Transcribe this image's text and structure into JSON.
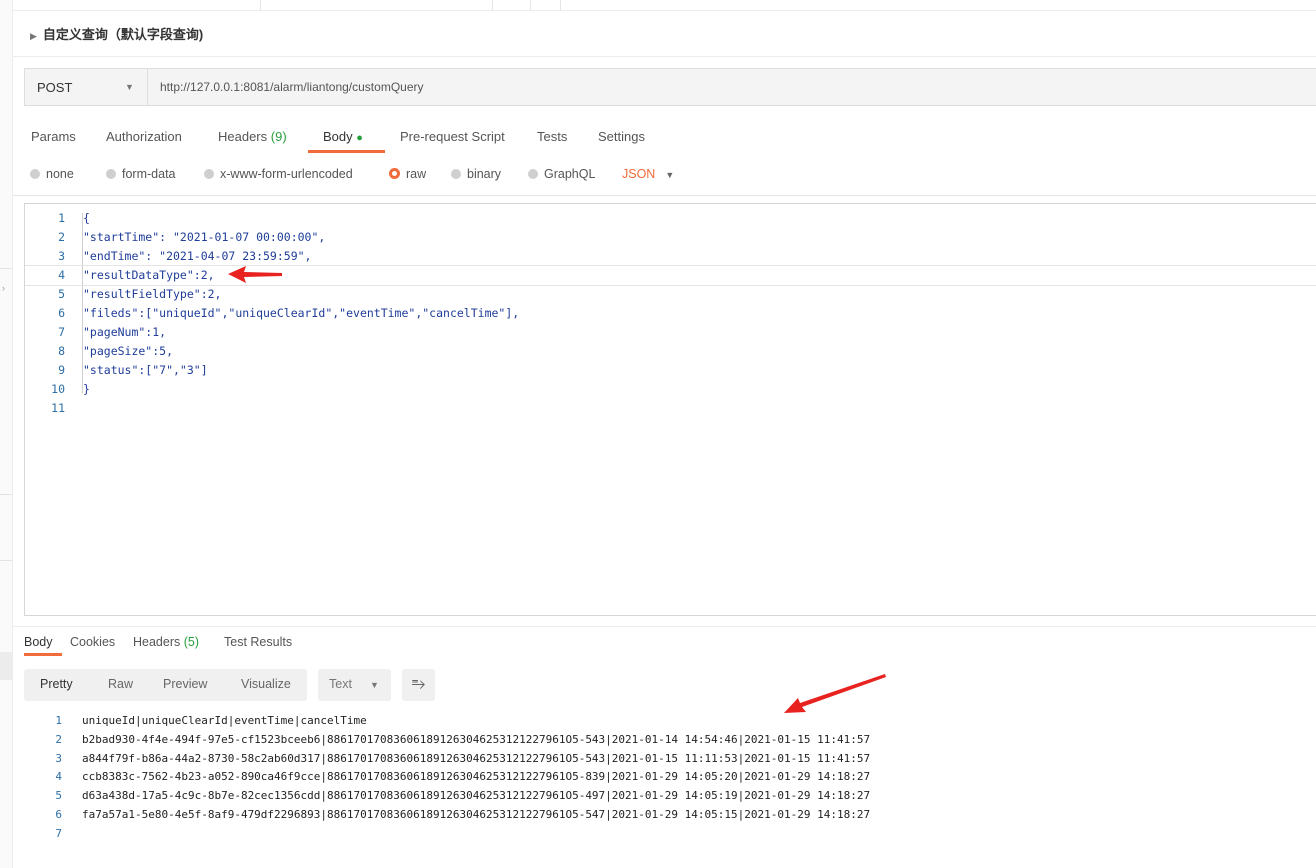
{
  "request": {
    "title": "自定义查询（默认字段查询)",
    "method": "POST",
    "url": "http://127.0.0.1:8081/alarm/liantong/customQuery"
  },
  "tabs": [
    {
      "label": "Params"
    },
    {
      "label": "Authorization"
    },
    {
      "label": "Headers",
      "count": "(9)"
    },
    {
      "label": "Body",
      "dot": "●"
    },
    {
      "label": "Pre-request Script"
    },
    {
      "label": "Tests"
    },
    {
      "label": "Settings"
    }
  ],
  "body_modes": [
    {
      "label": "none"
    },
    {
      "label": "form-data"
    },
    {
      "label": "x-www-form-urlencoded"
    },
    {
      "label": "raw"
    },
    {
      "label": "binary"
    },
    {
      "label": "GraphQL"
    }
  ],
  "body_format": "JSON",
  "request_body": {
    "line_numbers": [
      "1",
      "2",
      "3",
      "4",
      "5",
      "6",
      "7",
      "8",
      "9",
      "10",
      "11"
    ],
    "lines": [
      "{",
      "\"startTime\": \"2021-01-07 00:00:00\",",
      "\"endTime\": \"2021-04-07 23:59:59\",",
      "\"resultDataType\":2,",
      "\"resultFieldType\":2,",
      "\"fileds\":[\"uniqueId\",\"uniqueClearId\",\"eventTime\",\"cancelTime\"],",
      "\"pageNum\":1,",
      "\"pageSize\":5,",
      "\"status\":[\"7\",\"3\"]",
      "}",
      ""
    ]
  },
  "response_tabs": [
    {
      "label": "Body"
    },
    {
      "label": "Cookies"
    },
    {
      "label": "Headers",
      "count": "(5)"
    },
    {
      "label": "Test Results"
    }
  ],
  "view_modes": [
    "Pretty",
    "Raw",
    "Preview",
    "Visualize"
  ],
  "response_format": "Text",
  "response_body": {
    "line_numbers": [
      "1",
      "2",
      "3",
      "4",
      "5",
      "6",
      "7"
    ],
    "lines": [
      "uniqueId|uniqueClearId|eventTime|cancelTime",
      "b2bad930-4f4e-494f-97e5-cf1523bceeb6|886170170836061891263046253121227961O5-543|2021-01-14 14:54:46|2021-01-15 11:41:57",
      "a844f79f-b86a-44a2-8730-58c2ab60d317|886170170836061891263046253121227961O5-543|2021-01-15 11:11:53|2021-01-15 11:41:57",
      "ccb8383c-7562-4b23-a052-890ca46f9cce|886170170836061891263046253121227961O5-839|2021-01-29 14:05:20|2021-01-29 14:18:27",
      "d63a438d-17a5-4c9c-8b7e-82cec1356cdd|886170170836061891263046253121227961O5-497|2021-01-29 14:05:19|2021-01-29 14:18:27",
      "fa7a57a1-5e80-4e5f-8af9-479df2296893|886170170836061891263046253121227961O5-547|2021-01-29 14:05:15|2021-01-29 14:18:27",
      ""
    ]
  },
  "colors": {
    "accent": "#f26b3a",
    "success": "#26a03d",
    "annotation_arrow": "#e8231f"
  }
}
